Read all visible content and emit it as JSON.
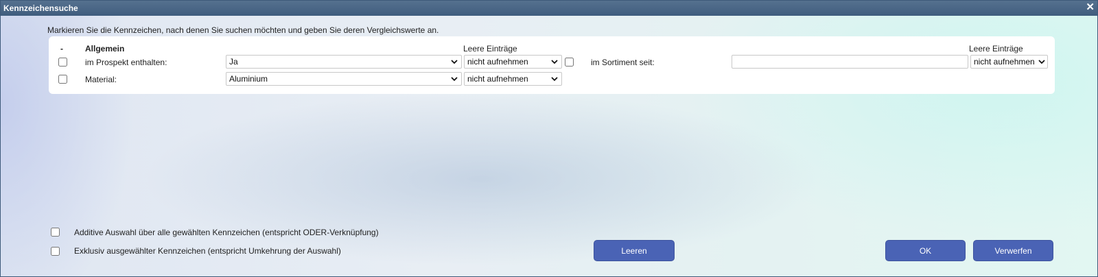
{
  "window": {
    "title": "Kennzeichensuche",
    "close_glyph": "✕"
  },
  "instruction": "Markieren Sie die Kennzeichen, nach denen Sie suchen möchten und geben Sie deren Vergleichswerte an.",
  "panel": {
    "dash": "-",
    "group_heading": "Allgemein",
    "empty_header_left": "Leere Einträge",
    "empty_header_right": "Leere Einträge",
    "rows": [
      {
        "label": "im Prospekt enthalten:",
        "value": "Ja",
        "empty": "nicht aufnehmen",
        "checked": false
      },
      {
        "label": "Material:",
        "value": "Aluminium",
        "empty": "nicht aufnehmen",
        "checked": false
      }
    ],
    "right_row": {
      "label": "im Sortiment seit:",
      "value": "",
      "empty": "nicht aufnehmen",
      "checked": false
    }
  },
  "options": {
    "additive": "Additive Auswahl über alle gewählten Kennzeichen (entspricht ODER-Verknüpfung)",
    "exclusive": "Exklusiv ausgewählter Kennzeichen (entspricht Umkehrung der Auswahl)"
  },
  "buttons": {
    "clear": "Leeren",
    "ok": "OK",
    "discard": "Verwerfen"
  },
  "colors": {
    "titlebar": "#47658a",
    "button": "#4a63b5",
    "panel": "#ffffff"
  }
}
